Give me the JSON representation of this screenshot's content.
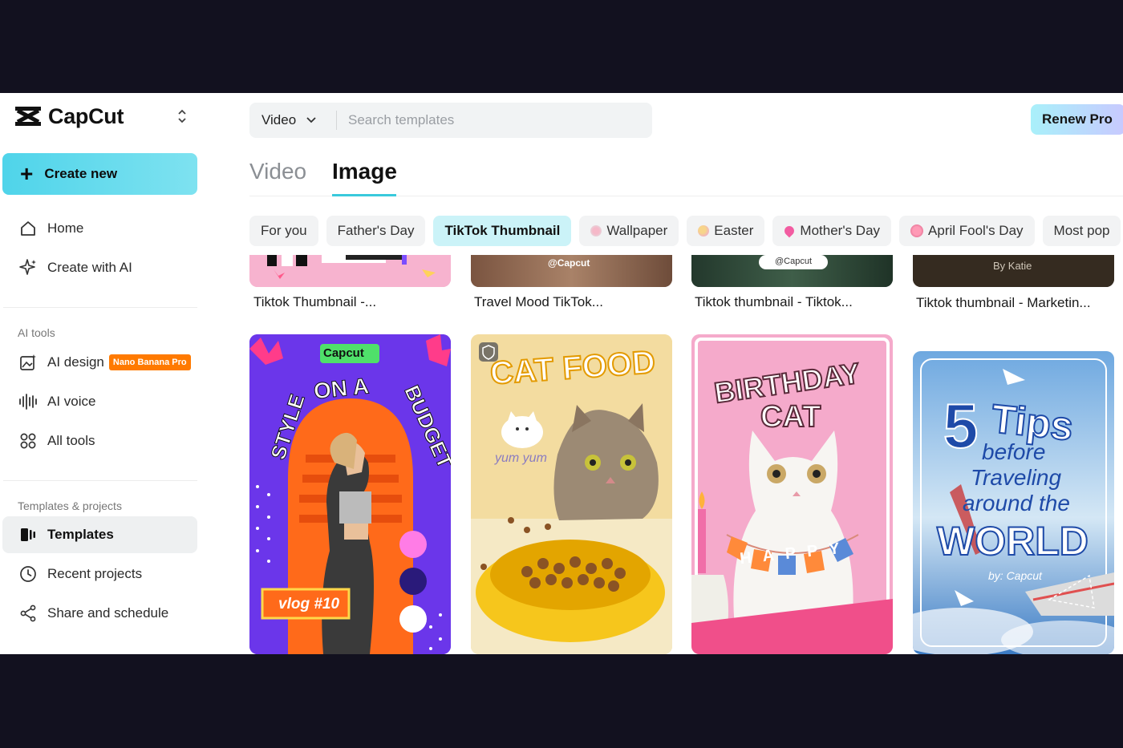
{
  "app": {
    "name": "CapCut"
  },
  "sidebar": {
    "create_label": "Create new",
    "primary": [
      {
        "label": "Home",
        "icon": "home-icon"
      },
      {
        "label": "Create with AI",
        "icon": "sparkle-icon"
      }
    ],
    "ai_tools_title": "AI tools",
    "ai_tools": [
      {
        "label": "AI design",
        "icon": "ai-design-icon",
        "badge": "Nano Banana Pro"
      },
      {
        "label": "AI voice",
        "icon": "waveform-icon"
      },
      {
        "label": "All tools",
        "icon": "grid-icon"
      }
    ],
    "projects_title": "Templates & projects",
    "projects": [
      {
        "label": "Templates",
        "icon": "templates-icon",
        "active": true
      },
      {
        "label": "Recent projects",
        "icon": "clock-icon"
      },
      {
        "label": "Share and schedule",
        "icon": "share-icon"
      }
    ]
  },
  "search": {
    "type": "Video",
    "placeholder": "Search templates"
  },
  "header": {
    "renew_label": "Renew Pro"
  },
  "tabs": [
    {
      "label": "Video",
      "active": false
    },
    {
      "label": "Image",
      "active": true
    }
  ],
  "chips": [
    {
      "label": "For you",
      "icon": ""
    },
    {
      "label": "Father's Day",
      "icon": ""
    },
    {
      "label": "TikTok Thumbnail",
      "icon": "",
      "active": true
    },
    {
      "label": "Wallpaper",
      "icon": "flower-icon"
    },
    {
      "label": "Easter",
      "icon": "egg-icon"
    },
    {
      "label": "Mother's Day",
      "icon": "heart-icon"
    },
    {
      "label": "April Fool's Day",
      "icon": "pig-icon"
    },
    {
      "label": "Most pop",
      "icon": ""
    }
  ],
  "top_row": [
    {
      "title": "Tiktok Thumbnail -...",
      "overlay": ""
    },
    {
      "title": "Travel Mood TikTok...",
      "overlay": "@Capcut"
    },
    {
      "title": "Tiktok thumbnail - Tiktok...",
      "overlay": "@Capcut"
    },
    {
      "title": "Tiktok thumbnail - Marketin...",
      "overlay": "By Katie"
    }
  ],
  "cards": [
    {
      "name": "style-on-a-budget",
      "brand": "Capcut",
      "line1": "STYLE",
      "line2": "ON A",
      "line3": "BUDGET",
      "tag": "vlog #10"
    },
    {
      "name": "cat-food",
      "title": "CAT FOOD",
      "caption": "yum yum"
    },
    {
      "name": "birthday-cat",
      "line1": "BIRTHDAY",
      "line2": "CAT",
      "banner": "HAPPY"
    },
    {
      "name": "5-tips-travel",
      "num": "5",
      "line1": "Tips",
      "line2": "before",
      "line3": "Traveling",
      "line4": "around the",
      "line5": "WORLD",
      "byline": "by: Capcut"
    }
  ],
  "colors": {
    "accent": "#39c9dc",
    "create_btn": "#4fd4ea",
    "badge": "#ff7a00",
    "active_chip": "#cbf3f8"
  }
}
